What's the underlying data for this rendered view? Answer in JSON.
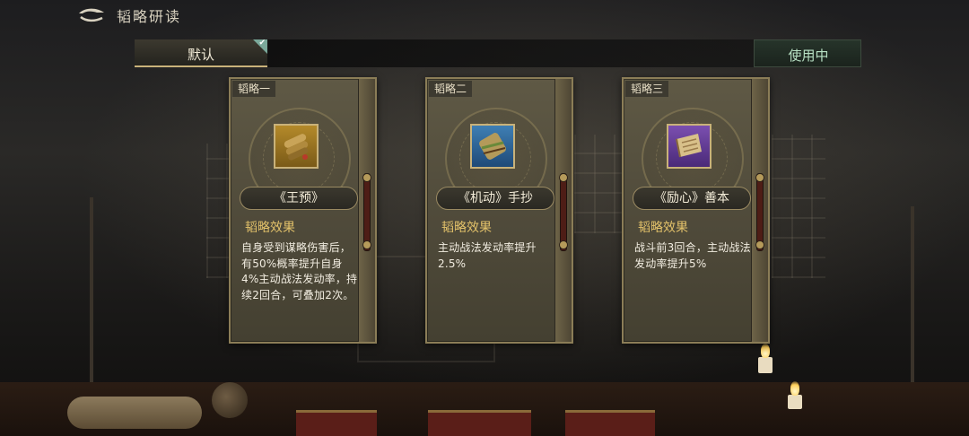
{
  "header": {
    "title": "韬略研读",
    "back_icon": "back-arrow-icon"
  },
  "tabs": {
    "default_label": "默认",
    "in_use_label": "使用中"
  },
  "colors": {
    "accent_gold": "#e3c26a",
    "in_use_green": "#b8e1c4",
    "check_teal": "#7aa89a"
  },
  "cards": [
    {
      "tag": "韬略一",
      "name": "《王预》",
      "item_frame": "yellow",
      "effect_label": "韬略效果",
      "effect_text": "自身受到谋略伤害后，有50%概率提升自身4%主动战法发动率，持续2回合，可叠加2次。"
    },
    {
      "tag": "韬略二",
      "name": "《机动》手抄",
      "item_frame": "blue",
      "effect_label": "韬略效果",
      "effect_text": "主动战法发动率提升2.5%"
    },
    {
      "tag": "韬略三",
      "name": "《励心》善本",
      "item_frame": "purple",
      "effect_label": "韬略效果",
      "effect_text": "战斗前3回合，主动战法发动率提升5%"
    }
  ]
}
